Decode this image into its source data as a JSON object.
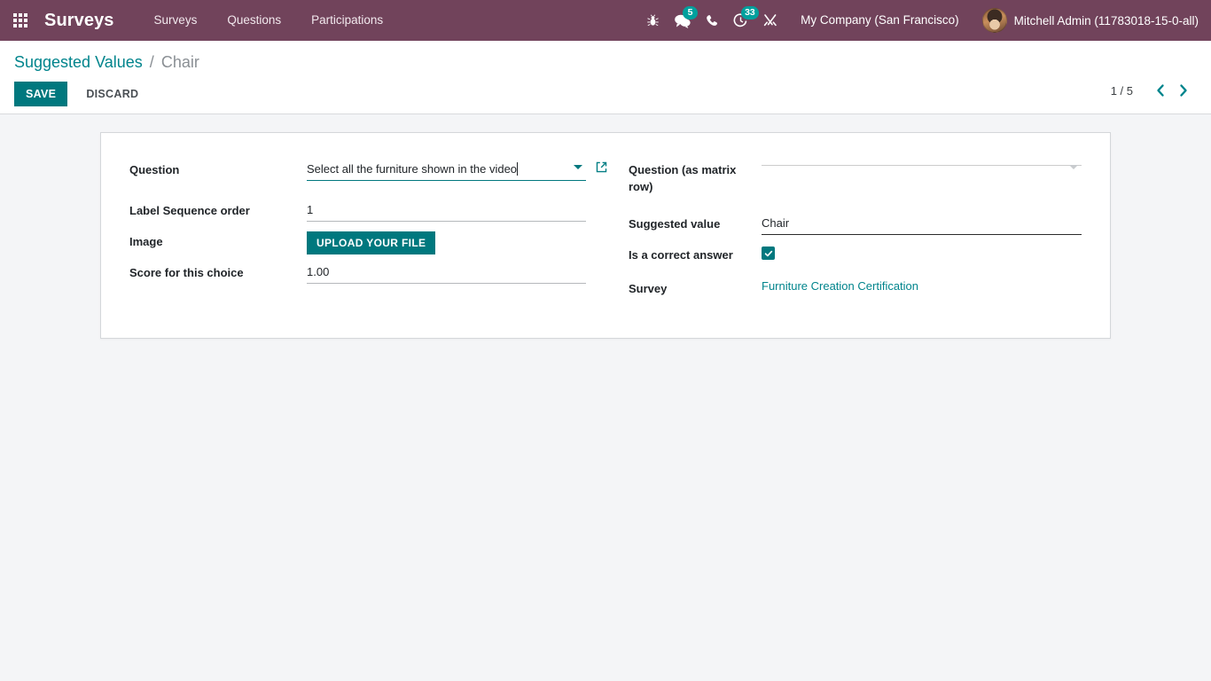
{
  "navbar": {
    "apps_icon": "apps-grid-icon",
    "brand": "Surveys",
    "menu": [
      {
        "label": "Surveys"
      },
      {
        "label": "Questions"
      },
      {
        "label": "Participations"
      }
    ],
    "system_icons": [
      {
        "name": "bug-icon",
        "badge": ""
      },
      {
        "name": "messages-icon",
        "badge": "5"
      },
      {
        "name": "phone-icon",
        "badge": ""
      },
      {
        "name": "activities-icon",
        "badge": "33"
      },
      {
        "name": "tools-icon",
        "badge": ""
      }
    ],
    "company": "My Company (San Francisco)",
    "user": "Mitchell Admin (11783018-15-0-all)"
  },
  "control_panel": {
    "breadcrumb_root": "Suggested Values",
    "breadcrumb_separator": "/",
    "breadcrumb_current": "Chair",
    "save_label": "SAVE",
    "discard_label": "DISCARD",
    "pager_text": "1 / 5",
    "pager_prev_icon": "chevron-left-icon",
    "pager_next_icon": "chevron-right-icon"
  },
  "form": {
    "left": {
      "question_label": "Question",
      "question_value": "Select all the furniture shown in the video",
      "question_dropdown_icon": "chevron-down-icon",
      "question_external_icon": "external-link-icon",
      "sequence_label": "Label Sequence order",
      "sequence_value": "1",
      "image_label": "Image",
      "upload_label": "UPLOAD YOUR FILE",
      "score_label": "Score for this choice",
      "score_value": "1.00"
    },
    "right": {
      "matrix_row_label": "Question (as matrix row)",
      "matrix_row_value": "",
      "matrix_row_dropdown_icon": "chevron-down-icon",
      "suggested_value_label": "Suggested value",
      "suggested_value_value": "Chair",
      "correct_answer_label": "Is a correct answer",
      "correct_answer_checked": true,
      "survey_label": "Survey",
      "survey_value": "Furniture Creation Certification"
    }
  },
  "colors": {
    "navbar_bg": "#71435b",
    "primary": "#00787e",
    "link": "#00848c",
    "badge": "#00a09d",
    "page_bg": "#f4f5f7"
  }
}
